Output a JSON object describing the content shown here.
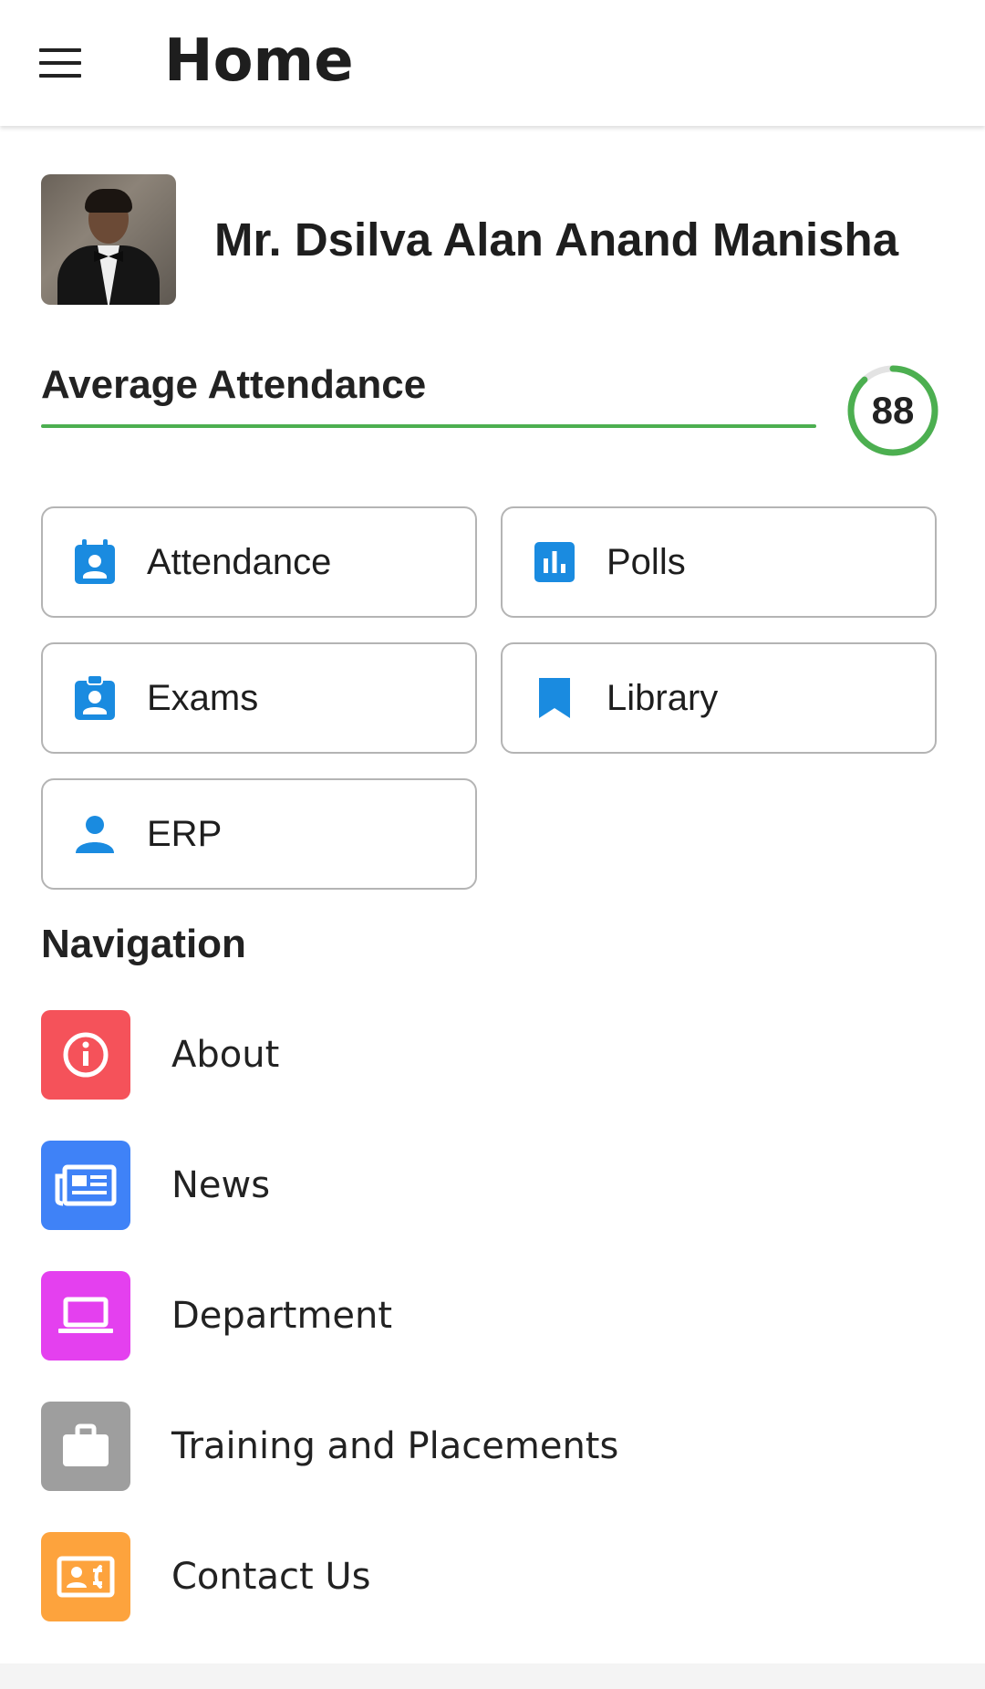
{
  "appbar": {
    "title": "Home",
    "menu_icon": "menu-icon"
  },
  "profile": {
    "name": "Mr. Dsilva Alan Anand Manisha",
    "avatar": "profile-photo"
  },
  "attendance": {
    "label": "Average Attendance",
    "value": "88",
    "progress_fraction": 0.88,
    "color": "#4caf50"
  },
  "quick_actions": [
    {
      "label": "Attendance",
      "icon": "calendar-person-icon"
    },
    {
      "label": "Polls",
      "icon": "poll-chart-icon"
    },
    {
      "label": "Exams",
      "icon": "clipboard-person-icon"
    },
    {
      "label": "Library",
      "icon": "bookmark-icon"
    },
    {
      "label": "ERP",
      "icon": "person-icon"
    }
  ],
  "quick_icon_color": "#1a8be0",
  "navigation": {
    "heading": "Navigation",
    "items": [
      {
        "label": "About",
        "icon": "info-icon",
        "color": "#f5525a"
      },
      {
        "label": "News",
        "icon": "newspaper-icon",
        "color": "#3f82f7"
      },
      {
        "label": "Department",
        "icon": "laptop-icon",
        "color": "#e440ef"
      },
      {
        "label": "Training and Placements",
        "icon": "briefcase-icon",
        "color": "#9e9e9e"
      },
      {
        "label": "Contact Us",
        "icon": "contact-card-icon",
        "color": "#fda33d"
      }
    ]
  }
}
